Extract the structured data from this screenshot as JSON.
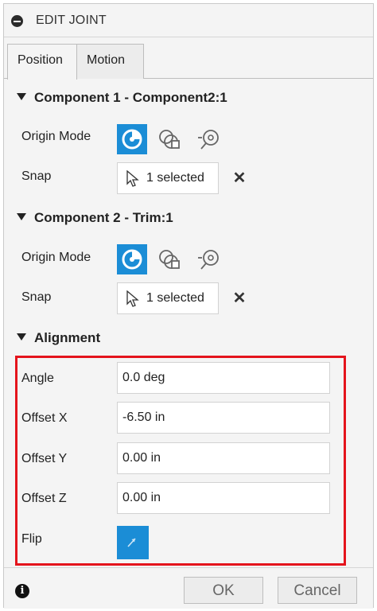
{
  "dialog": {
    "title": "EDIT JOINT"
  },
  "tabs": [
    {
      "label": "Position",
      "active": true
    },
    {
      "label": "Motion",
      "active": false
    }
  ],
  "component1": {
    "header": "Component 1 - Component2:1",
    "origin_mode_label": "Origin Mode",
    "snap_label": "Snap",
    "snap_value": "1 selected",
    "clear_glyph": "✕"
  },
  "component2": {
    "header": "Component 2 - Trim:1",
    "origin_mode_label": "Origin Mode",
    "snap_label": "Snap",
    "snap_value": "1 selected",
    "clear_glyph": "✕"
  },
  "alignment": {
    "header": "Alignment",
    "angle_label": "Angle",
    "angle_value": "0.0 deg",
    "offset_x_label": "Offset X",
    "offset_x_value": "-6.50 in",
    "offset_y_label": "Offset Y",
    "offset_y_value": "0.00 in",
    "offset_z_label": "Offset Z",
    "offset_z_value": "0.00 in",
    "flip_label": "Flip"
  },
  "footer": {
    "info_glyph": "i",
    "ok_label": "OK",
    "cancel_label": "Cancel"
  },
  "colors": {
    "accent": "#1b8dd6",
    "highlight": "#e4141c"
  },
  "icons": {
    "origin_modes": [
      "simple-origin-icon",
      "between-two-faces-icon",
      "two-edge-intersection-icon"
    ],
    "snap": "cursor-pointer-icon",
    "flip": "flip-arrow-icon"
  }
}
